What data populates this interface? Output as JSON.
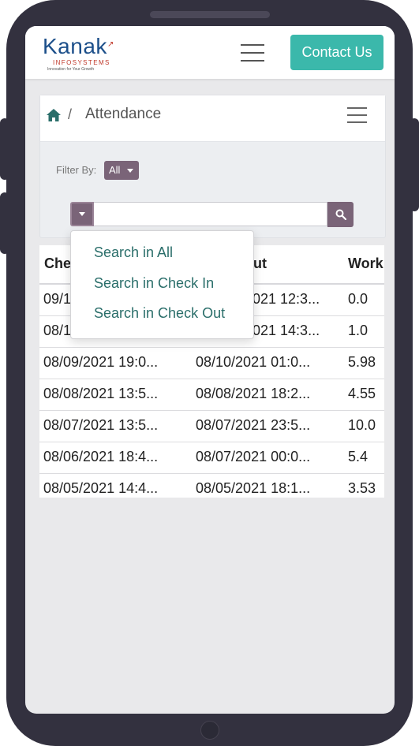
{
  "brand": {
    "name": "Kanak",
    "sub": "INFOSYSTEMS",
    "tagline": "Innovation for Your Growth"
  },
  "header": {
    "menu_icon": "hamburger-icon",
    "contact_label": "Contact Us",
    "accent_color": "#3bb8ab"
  },
  "breadcrumb": {
    "home_icon": "home-icon",
    "separator": "/",
    "title": "Attendance",
    "menu_icon": "hamburger-icon"
  },
  "filter": {
    "label": "Filter By:",
    "selected": "All"
  },
  "search": {
    "dropdown_icon": "caret-down-icon",
    "search_icon": "search-icon",
    "value": "",
    "options": [
      "Search in All",
      "Search in Check In",
      "Search in Check Out"
    ]
  },
  "table": {
    "columns": [
      "Check In",
      "Check Out",
      "Work"
    ],
    "rows": [
      {
        "check_in": "09/1",
        "check_out": "021 12:3...",
        "work": "0.0"
      },
      {
        "check_in": "08/1",
        "check_out": "021 14:3...",
        "work": "1.0"
      },
      {
        "check_in": "08/09/2021 19:0...",
        "check_out": "08/10/2021 01:0...",
        "work": "5.98"
      },
      {
        "check_in": "08/08/2021 13:5...",
        "check_out": "08/08/2021 18:2...",
        "work": "4.55"
      },
      {
        "check_in": "08/07/2021 13:5...",
        "check_out": "08/07/2021 23:5...",
        "work": "10.0"
      },
      {
        "check_in": "08/06/2021 18:4...",
        "check_out": "08/07/2021 00:0...",
        "work": "5.4"
      },
      {
        "check_in": "08/05/2021 14:4...",
        "check_out": "08/05/2021 18:1...",
        "work": "3.53"
      }
    ]
  }
}
